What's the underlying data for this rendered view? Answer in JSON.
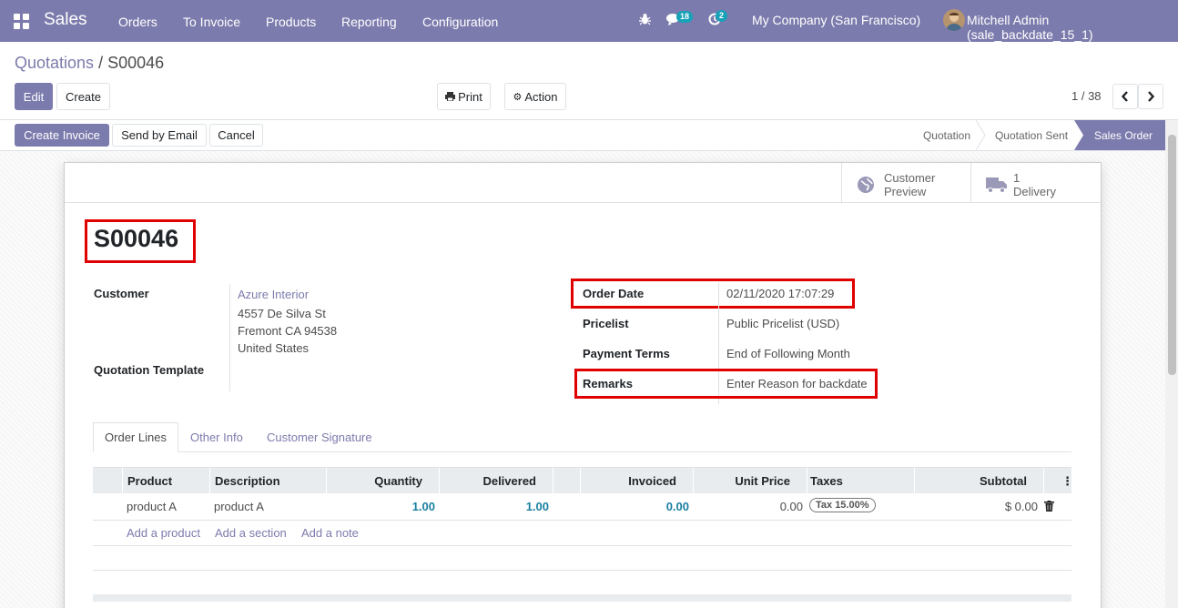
{
  "navbar": {
    "app_name": "Sales",
    "menu": [
      "Orders",
      "To Invoice",
      "Products",
      "Reporting",
      "Configuration"
    ],
    "messages_count": "18",
    "activities_count": "2",
    "company": "My Company (San Francisco)",
    "user": "Mitchell Admin (sale_backdate_15_1)",
    "brand_color": "#7c7bad"
  },
  "breadcrumb": {
    "parent": "Quotations",
    "separator": " / ",
    "current": "S00046"
  },
  "buttons": {
    "edit": "Edit",
    "create": "Create",
    "print": "Print",
    "action": "Action"
  },
  "pager": {
    "value": "1 / 38"
  },
  "status_buttons": {
    "create_invoice": "Create Invoice",
    "send_email": "Send by Email",
    "cancel": "Cancel"
  },
  "stages": [
    {
      "label": "Quotation",
      "active": false
    },
    {
      "label": "Quotation Sent",
      "active": false
    },
    {
      "label": "Sales Order",
      "active": true
    }
  ],
  "smart_buttons": {
    "preview": [
      "Customer",
      "Preview"
    ],
    "delivery": [
      "1",
      "Delivery"
    ]
  },
  "form": {
    "name": "S00046",
    "customer_label": "Customer",
    "customer_name": "Azure Interior",
    "customer_address": [
      "4557 De Silva St",
      "Fremont CA 94538",
      "United States"
    ],
    "template_label": "Quotation Template",
    "order_date_label": "Order Date",
    "order_date": "02/11/2020 17:07:29",
    "pricelist_label": "Pricelist",
    "pricelist": "Public Pricelist (USD)",
    "payment_terms_label": "Payment Terms",
    "payment_terms": "End of Following Month",
    "remarks_label": "Remarks",
    "remarks": "Enter Reason for backdate"
  },
  "tabs": [
    "Order Lines",
    "Other Info",
    "Customer Signature"
  ],
  "table": {
    "headers": [
      "Product",
      "Description",
      "Quantity",
      "Delivered",
      "Invoiced",
      "Unit Price",
      "Taxes",
      "Subtotal"
    ],
    "rows": [
      {
        "product": "product A",
        "description": "product A",
        "quantity": "1.00",
        "delivered": "1.00",
        "invoiced": "0.00",
        "unit_price": "0.00",
        "tax": "Tax 15.00%",
        "subtotal": "$ 0.00"
      }
    ],
    "add_links": [
      "Add a product",
      "Add a section",
      "Add a note"
    ]
  }
}
